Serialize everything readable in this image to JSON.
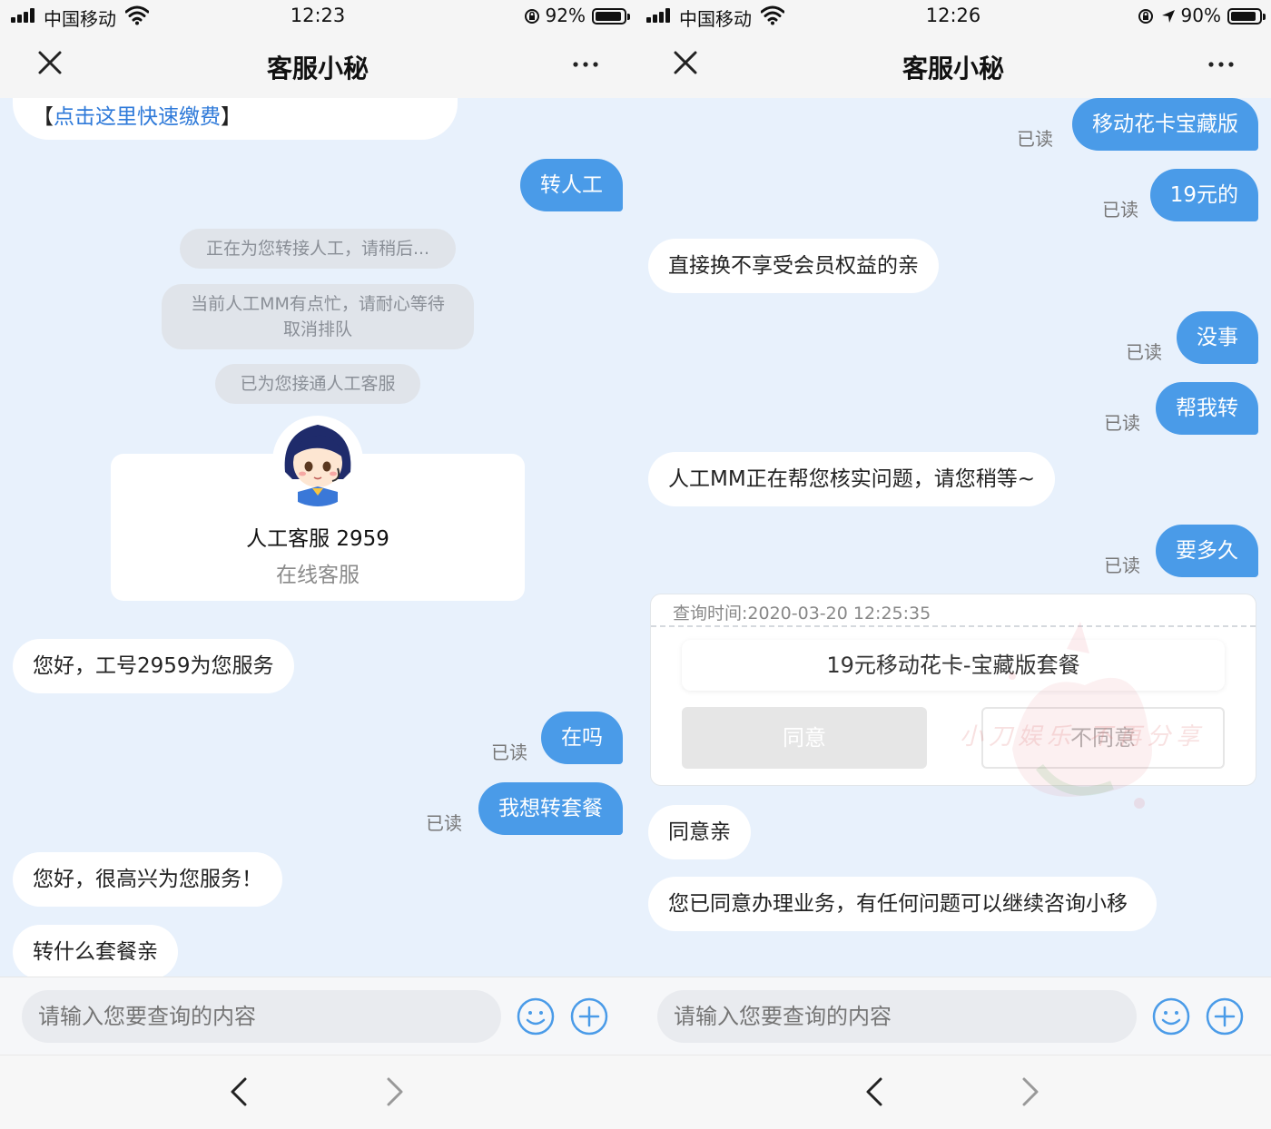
{
  "colors": {
    "accent_blue": "#4a9be8",
    "chat_bg": "#e8f1fc",
    "bubble_in": "#ffffff",
    "link_blue": "#2f7ad9"
  },
  "left": {
    "status": {
      "carrier": "中国移动",
      "time": "12:23",
      "battery": "92%",
      "battery_level": 0.92
    },
    "nav": {
      "title": "客服小秘"
    },
    "messages": {
      "pay_open": "【",
      "pay_link": "点击这里快速缴费",
      "pay_close": "】",
      "transfer": "转人工",
      "sys1": "正在为您转接人工，请稍后...",
      "sys2_line1": "当前人工MM有点忙，请耐心等待",
      "sys2_line2": "取消排队",
      "sys3": "已为您接通人工客服",
      "agent_name": "人工客服 2959",
      "agent_role": "在线客服",
      "greet": "您好，工号2959为您服务",
      "read1": "已读",
      "here": "在吗",
      "read2": "已读",
      "want_change": "我想转套餐",
      "happy": "您好，很高兴为您服务！",
      "which_plan": "转什么套餐亲"
    },
    "input": {
      "placeholder": "请输入您要查询的内容"
    }
  },
  "right": {
    "status": {
      "carrier": "中国移动",
      "time": "12:26",
      "battery": "90%",
      "battery_level": 0.9
    },
    "nav": {
      "title": "客服小秘"
    },
    "messages": {
      "read1": "已读",
      "plan_name": "移动花卡宝藏版",
      "read2": "已读",
      "price": "19元的",
      "no_benefit": "直接换不享受会员权益的亲",
      "read3": "已读",
      "ok": "没事",
      "read4": "已读",
      "help": "帮我转",
      "checking": "人工MM正在帮您核实问题，请您稍等~",
      "read5": "已读",
      "how_long": "要多久",
      "agreed": "同意亲",
      "agreed_long": "您已同意办理业务，有任何问题可以继续咨询小移"
    },
    "order": {
      "query_time": "查询时间:2020-03-20 12:25:35",
      "plan": "19元移动花卡-宝藏版套餐",
      "agree": "同意",
      "disagree": "不同意",
      "watermark": "小刀娱乐 不再分享"
    },
    "input": {
      "placeholder": "请输入您要查询的内容"
    }
  }
}
